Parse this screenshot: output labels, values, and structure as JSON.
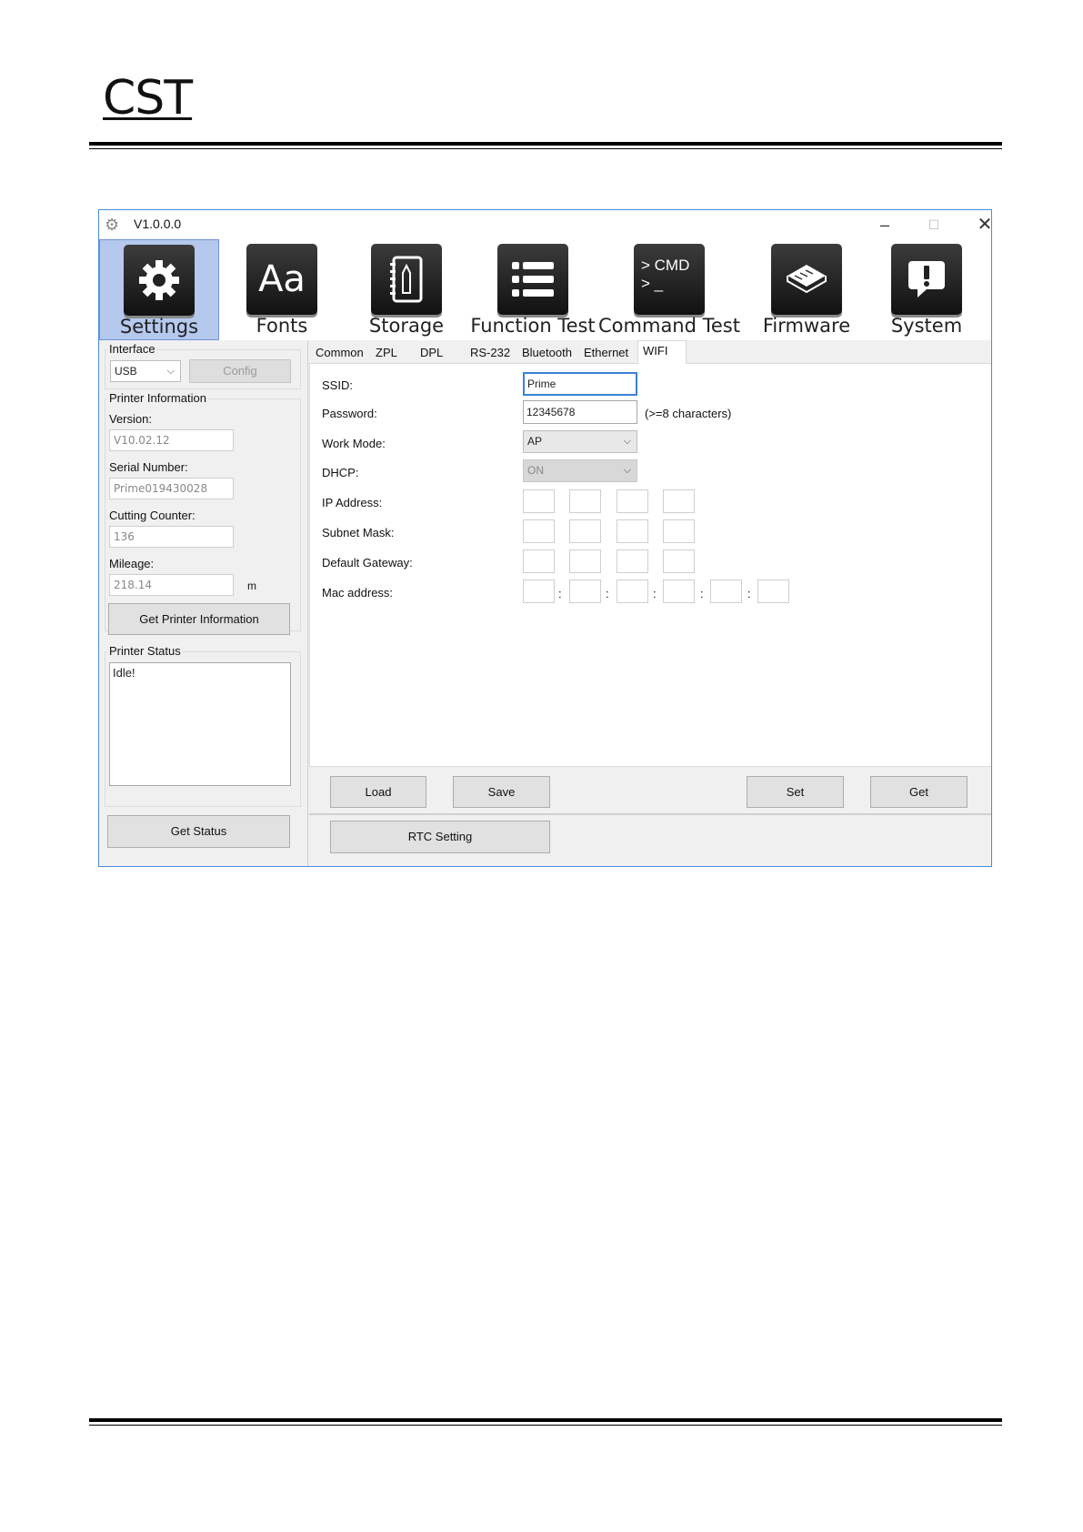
{
  "document": {
    "brand": "CST"
  },
  "window": {
    "title": "V1.0.0.0",
    "minimize_glyph": "–",
    "maximize_glyph": "☐",
    "close_glyph": "✕",
    "app_icon": "gear-icon"
  },
  "toolbar": {
    "items": [
      {
        "label": "Settings",
        "icon": "gear-icon"
      },
      {
        "label": "Fonts",
        "icon": "fonts-icon",
        "glyph": "Aa"
      },
      {
        "label": "Storage",
        "icon": "notebook-icon"
      },
      {
        "label": "Function Test",
        "icon": "list-icon"
      },
      {
        "label": "Command Test",
        "icon": "terminal-icon",
        "glyph": "> CMD\n> _"
      },
      {
        "label": "Firmware",
        "icon": "chip-icon"
      },
      {
        "label": "System",
        "icon": "alert-icon"
      }
    ],
    "active": "Settings",
    "active_color": "#b5c8ee"
  },
  "left": {
    "interface": {
      "title": "Interface",
      "selected": "USB",
      "config_label": "Config"
    },
    "printer_info": {
      "title": "Printer Information",
      "version_label": "Version:",
      "version": "V10.02.12",
      "serial_label": "Serial Number:",
      "serial": "Prime019430028",
      "cutting_label": "Cutting Counter:",
      "cutting": "136",
      "mileage_label": "Mileage:",
      "mileage": "218.14",
      "mileage_unit": "m",
      "get_button": "Get Printer Information"
    },
    "status": {
      "title": "Printer Status",
      "text": "Idle!",
      "get_button": "Get Status"
    }
  },
  "tabs": [
    "Common",
    "ZPL",
    "DPL",
    "RS-232",
    "Bluetooth",
    "Ethernet",
    "WIFI"
  ],
  "active_tab": "WIFI",
  "wifi": {
    "ssid_label": "SSID:",
    "ssid": "Prime",
    "password_label": "Password:",
    "password": "12345678",
    "password_hint": "(>=8 characters)",
    "work_mode_label": "Work Mode:",
    "work_mode": "AP",
    "dhcp_label": "DHCP:",
    "dhcp": "ON",
    "ip_label": "IP Address:",
    "subnet_label": "Subnet Mask:",
    "gateway_label": "Default Gateway:",
    "mac_label": "Mac address:",
    "mac_separator": ":"
  },
  "actions": {
    "load": "Load",
    "save": "Save",
    "set": "Set",
    "get": "Get",
    "rtc": "RTC Setting"
  }
}
